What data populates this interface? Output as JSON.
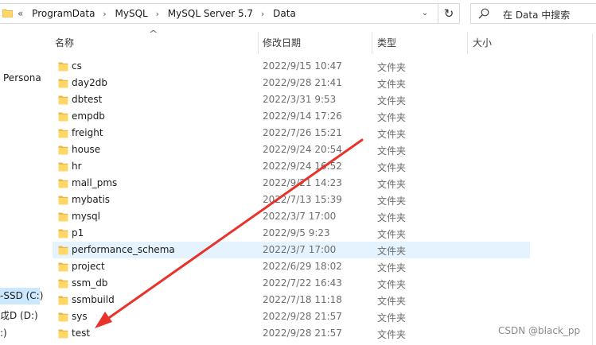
{
  "address": {
    "overflow": "«",
    "crumbs": [
      "ProgramData",
      "MySQL",
      "MySQL Server 5.7",
      "Data"
    ],
    "separator": "›",
    "dropdown": "⌄",
    "refresh_icon": "↻"
  },
  "search": {
    "placeholder": "在 Data 中搜索"
  },
  "nav": {
    "items": [
      {
        "label": "Persona",
        "selected": false
      },
      {
        "label": "-SSD (C:)",
        "selected": true
      },
      {
        "label": "戉D (D:)",
        "selected": false
      },
      {
        "label": ":)",
        "selected": false
      }
    ]
  },
  "columns": {
    "name": "名称",
    "modified": "修改日期",
    "type": "类型",
    "size": "大小",
    "sort_arrow": "^"
  },
  "files": [
    {
      "name": "cs",
      "modified": "2022/9/15 10:47",
      "type": "文件夹"
    },
    {
      "name": "day2db",
      "modified": "2022/9/28 21:41",
      "type": "文件夹"
    },
    {
      "name": "dbtest",
      "modified": "2022/3/31 9:53",
      "type": "文件夹"
    },
    {
      "name": "empdb",
      "modified": "2022/9/14 17:26",
      "type": "文件夹"
    },
    {
      "name": "freight",
      "modified": "2022/7/26 15:21",
      "type": "文件夹"
    },
    {
      "name": "house",
      "modified": "2022/9/24 20:54",
      "type": "文件夹"
    },
    {
      "name": "hr",
      "modified": "2022/9/24 16:52",
      "type": "文件夹"
    },
    {
      "name": "mall_pms",
      "modified": "2022/9/21 14:23",
      "type": "文件夹"
    },
    {
      "name": "mybatis",
      "modified": "2022/7/13 15:39",
      "type": "文件夹"
    },
    {
      "name": "mysql",
      "modified": "2022/3/7 17:00",
      "type": "文件夹"
    },
    {
      "name": "p1",
      "modified": "2022/9/5 9:23",
      "type": "文件夹"
    },
    {
      "name": "performance_schema",
      "modified": "2022/3/7 17:00",
      "type": "文件夹",
      "hovered": true
    },
    {
      "name": "project",
      "modified": "2022/6/29 18:02",
      "type": "文件夹"
    },
    {
      "name": "ssm_db",
      "modified": "2022/7/22 16:43",
      "type": "文件夹"
    },
    {
      "name": "ssmbuild",
      "modified": "2022/7/18 11:18",
      "type": "文件夹"
    },
    {
      "name": "sys",
      "modified": "2022/9/28 21:57",
      "type": "文件夹"
    },
    {
      "name": "test",
      "modified": "2022/9/28 21:57",
      "type": "文件夹"
    }
  ],
  "colors": {
    "folder": "#ffd766",
    "folder_dark": "#e8b84a",
    "hover_row": "#e5f3ff",
    "nav_selected": "#cce8ff",
    "arrow": "#e8322a"
  },
  "watermark": "CSDN @black_pp"
}
